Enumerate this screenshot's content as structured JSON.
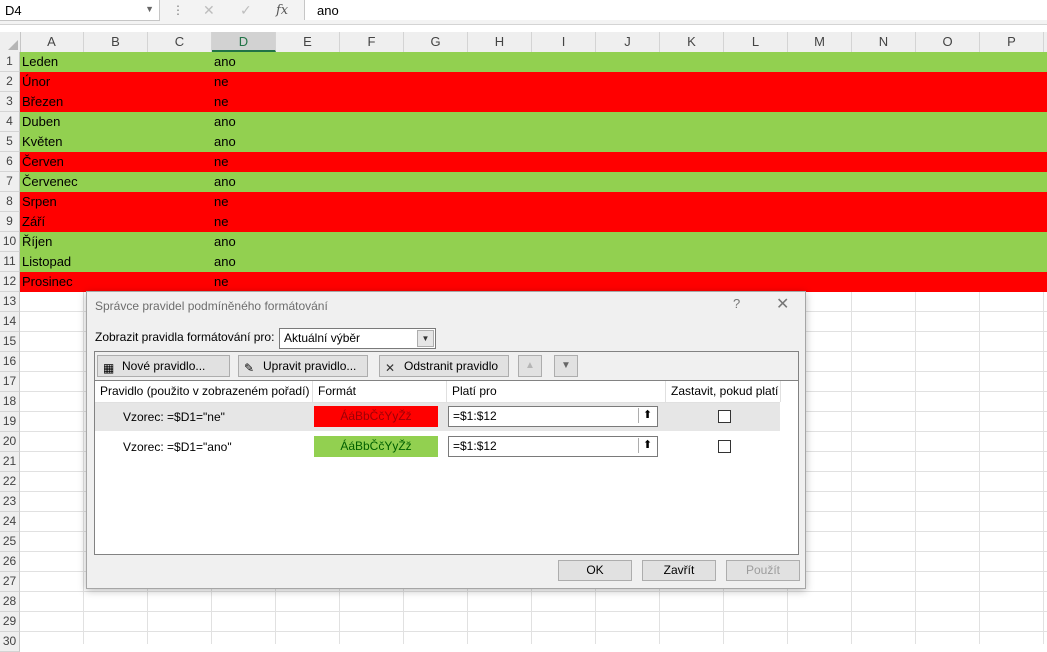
{
  "formula_bar": {
    "name_box": "D4",
    "cancel_glyph": "✕",
    "enter_glyph": "✓",
    "fx_label": "fx",
    "formula": "ano"
  },
  "grid": {
    "columns": [
      "A",
      "B",
      "C",
      "D",
      "E",
      "F",
      "G",
      "H",
      "I",
      "J",
      "K",
      "L",
      "M",
      "N",
      "O",
      "P"
    ],
    "selected_column": "D",
    "row_numbers": [
      "1",
      "2",
      "3",
      "4",
      "5",
      "6",
      "7",
      "8",
      "9",
      "10",
      "11",
      "12",
      "13",
      "14",
      "15",
      "16",
      "17",
      "18",
      "19",
      "20",
      "21",
      "22",
      "23",
      "24",
      "25",
      "26",
      "27",
      "28",
      "29",
      "30"
    ],
    "rows": [
      {
        "a": "Leden",
        "d": "ano",
        "fill": "green"
      },
      {
        "a": "Únor",
        "d": "ne",
        "fill": "red"
      },
      {
        "a": "Březen",
        "d": "ne",
        "fill": "red"
      },
      {
        "a": "Duben",
        "d": "ano",
        "fill": "green"
      },
      {
        "a": "Květen",
        "d": "ano",
        "fill": "green"
      },
      {
        "a": "Červen",
        "d": "ne",
        "fill": "red"
      },
      {
        "a": "Červenec",
        "d": "ano",
        "fill": "green"
      },
      {
        "a": "Srpen",
        "d": "ne",
        "fill": "red"
      },
      {
        "a": "Září",
        "d": "ne",
        "fill": "red"
      },
      {
        "a": "Říjen",
        "d": "ano",
        "fill": "green"
      },
      {
        "a": "Listopad",
        "d": "ano",
        "fill": "green"
      },
      {
        "a": "Prosinec",
        "d": "ne",
        "fill": "red"
      }
    ],
    "colors": {
      "green": "#92d050",
      "red": "#ff0000"
    }
  },
  "dialog": {
    "title": "Správce pravidel podmíněného formátování",
    "help": "?",
    "close": "✕",
    "show_rules_label": "Zobrazit pravidla formátování pro:",
    "show_rules_value": "Aktuální výběr",
    "toolbar": {
      "new_rule": "Nové pravidlo...",
      "edit_rule": "Upravit pravidlo...",
      "delete_rule": "Odstranit pravidlo"
    },
    "columns": {
      "rule": "Pravidlo (použito v zobrazeném pořadí)",
      "format": "Formát",
      "applies_to": "Platí pro",
      "stop_if_true": "Zastavit, pokud platí"
    },
    "rules": [
      {
        "rule": "Vzorec: =$D1=\"ne\"",
        "preview": "ÁáBbČčYyŽž",
        "applies_to": "=$1:$12",
        "stop": false
      },
      {
        "rule": "Vzorec: =$D1=\"ano\"",
        "preview": "ÁáBbČčYyŽž",
        "applies_to": "=$1:$12",
        "stop": false
      }
    ],
    "buttons": {
      "ok": "OK",
      "close": "Zavřít",
      "apply": "Použít"
    }
  }
}
